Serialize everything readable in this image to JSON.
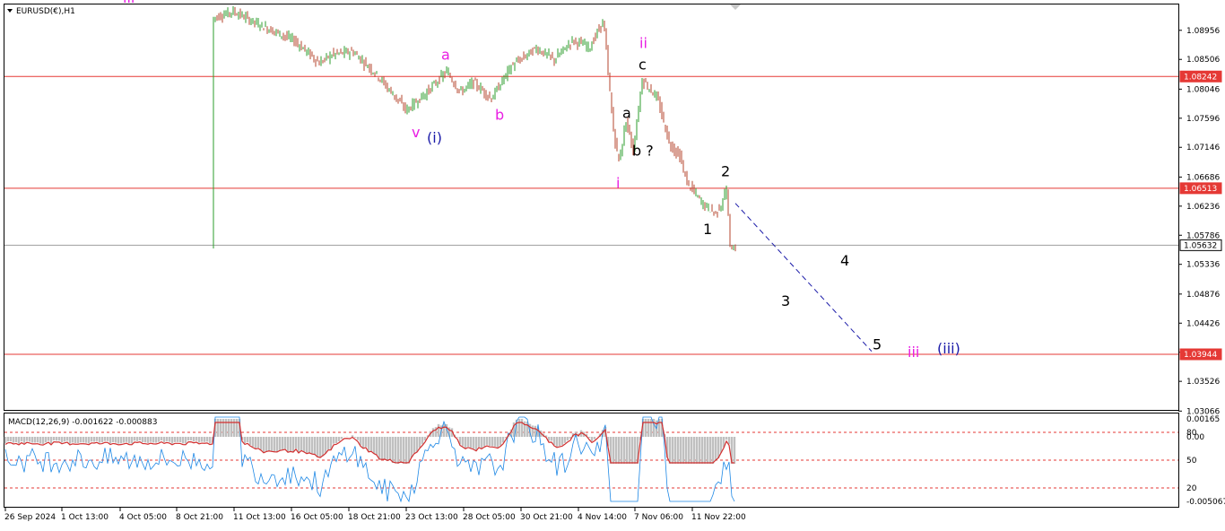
{
  "chart_data": {
    "type": "line",
    "title": "EURUSD(€),H1",
    "y_axis": {
      "range": [
        1.0307,
        1.093
      ],
      "ticks": [
        "1.08956",
        "1.08506",
        "1.08046",
        "1.07596",
        "1.07146",
        "1.06686",
        "1.06236",
        "1.05786",
        "1.05336",
        "1.04876",
        "1.04426",
        "1.03976",
        "1.03526",
        "1.03066"
      ]
    },
    "x_axis": {
      "ticks": [
        "26 Sep 2024",
        "1 Oct 13:00",
        "4 Oct 05:00",
        "8 Oct 21:00",
        "11 Oct 13:00",
        "16 Oct 05:00",
        "18 Oct 21:00",
        "23 Oct 13:00",
        "28 Oct 05:00",
        "30 Oct 21:00",
        "4 Nov 14:00",
        "7 Nov 06:00",
        "11 Nov 22:00"
      ]
    },
    "series": [
      {
        "name": "EURUSD H1",
        "x": [
          "26 Sep 2024",
          "1 Oct 13:00",
          "4 Oct 05:00",
          "8 Oct 21:00",
          "11 Oct 13:00",
          "16 Oct 05:00",
          "18 Oct 21:00",
          "23 Oct 13:00",
          "28 Oct 05:00",
          "30 Oct 21:00",
          "4 Nov 14:00",
          "7 Nov 06:00",
          "11 Nov 22:00"
        ],
        "values": [
          1.109,
          1.112,
          1.099,
          1.0935,
          1.0885,
          1.0855,
          1.081,
          1.079,
          1.08,
          1.086,
          1.089,
          1.072,
          1.056
        ]
      }
    ],
    "horizontal_levels": [
      {
        "value": "1.08242",
        "color": "#e53935"
      },
      {
        "value": "1.06513",
        "color": "#e53935"
      },
      {
        "value": "1.05632",
        "color": "#9e9e9e"
      },
      {
        "value": "1.03944",
        "color": "#e53935"
      }
    ],
    "projection": {
      "from_price": 1.0628,
      "to_price": 1.0399
    },
    "wave_labels": [
      {
        "text": "iii",
        "color": "#e91ee3",
        "price": 1.0938
      },
      {
        "text": "a",
        "color": "#e91ee3",
        "price": 1.085
      },
      {
        "text": "b",
        "color": "#e91ee3",
        "price": 1.0757
      },
      {
        "text": "v",
        "color": "#e91ee3",
        "price": 1.073
      },
      {
        "text": "(i)",
        "color": "#1a1aa8",
        "price": 1.0722
      },
      {
        "text": "ii",
        "color": "#e91ee3",
        "price": 1.0868
      },
      {
        "text": "c",
        "color": "#000000",
        "price": 1.0835
      },
      {
        "text": "a",
        "color": "#000000",
        "price": 1.076
      },
      {
        "text": "b ?",
        "color": "#000000",
        "price": 1.0702
      },
      {
        "text": "i",
        "color": "#e91ee3",
        "price": 1.0652
      },
      {
        "text": "2",
        "color": "#000000",
        "price": 1.067
      },
      {
        "text": "1",
        "color": "#000000",
        "price": 1.058
      },
      {
        "text": "4",
        "color": "#000000",
        "price": 1.0532
      },
      {
        "text": "3",
        "color": "#000000",
        "price": 1.0469
      },
      {
        "text": "5",
        "color": "#000000",
        "price": 1.0402
      },
      {
        "text": "iii",
        "color": "#e91ee3",
        "price": 1.039
      },
      {
        "text": "(iii)",
        "color": "#1a1aa8",
        "price": 1.0396
      }
    ],
    "macd": {
      "label": "MACD(12,26,9) -0.001622 -0.000883",
      "ticks": [
        "0.00165",
        "0.00",
        "-0.005067"
      ],
      "levels": [
        "80",
        "50",
        "20"
      ]
    },
    "grid": false,
    "colors": {
      "up": "#2e9e2e",
      "down": "#b5462d",
      "level": "#e53935",
      "current": "#9e9e9e",
      "projection": "#1a1aa8",
      "macd_hist": "#c0c0c0",
      "macd_signal": "#d32f2f",
      "stoch": "#1e88e5"
    }
  }
}
